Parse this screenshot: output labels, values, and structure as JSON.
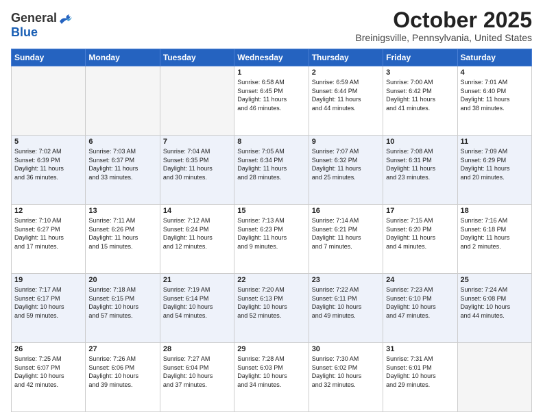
{
  "header": {
    "logo_general": "General",
    "logo_blue": "Blue",
    "month": "October 2025",
    "location": "Breinigsville, Pennsylvania, United States"
  },
  "days_of_week": [
    "Sunday",
    "Monday",
    "Tuesday",
    "Wednesday",
    "Thursday",
    "Friday",
    "Saturday"
  ],
  "weeks": [
    [
      {
        "day": "",
        "content": ""
      },
      {
        "day": "",
        "content": ""
      },
      {
        "day": "",
        "content": ""
      },
      {
        "day": "1",
        "content": "Sunrise: 6:58 AM\nSunset: 6:45 PM\nDaylight: 11 hours\nand 46 minutes."
      },
      {
        "day": "2",
        "content": "Sunrise: 6:59 AM\nSunset: 6:44 PM\nDaylight: 11 hours\nand 44 minutes."
      },
      {
        "day": "3",
        "content": "Sunrise: 7:00 AM\nSunset: 6:42 PM\nDaylight: 11 hours\nand 41 minutes."
      },
      {
        "day": "4",
        "content": "Sunrise: 7:01 AM\nSunset: 6:40 PM\nDaylight: 11 hours\nand 38 minutes."
      }
    ],
    [
      {
        "day": "5",
        "content": "Sunrise: 7:02 AM\nSunset: 6:39 PM\nDaylight: 11 hours\nand 36 minutes."
      },
      {
        "day": "6",
        "content": "Sunrise: 7:03 AM\nSunset: 6:37 PM\nDaylight: 11 hours\nand 33 minutes."
      },
      {
        "day": "7",
        "content": "Sunrise: 7:04 AM\nSunset: 6:35 PM\nDaylight: 11 hours\nand 30 minutes."
      },
      {
        "day": "8",
        "content": "Sunrise: 7:05 AM\nSunset: 6:34 PM\nDaylight: 11 hours\nand 28 minutes."
      },
      {
        "day": "9",
        "content": "Sunrise: 7:07 AM\nSunset: 6:32 PM\nDaylight: 11 hours\nand 25 minutes."
      },
      {
        "day": "10",
        "content": "Sunrise: 7:08 AM\nSunset: 6:31 PM\nDaylight: 11 hours\nand 23 minutes."
      },
      {
        "day": "11",
        "content": "Sunrise: 7:09 AM\nSunset: 6:29 PM\nDaylight: 11 hours\nand 20 minutes."
      }
    ],
    [
      {
        "day": "12",
        "content": "Sunrise: 7:10 AM\nSunset: 6:27 PM\nDaylight: 11 hours\nand 17 minutes."
      },
      {
        "day": "13",
        "content": "Sunrise: 7:11 AM\nSunset: 6:26 PM\nDaylight: 11 hours\nand 15 minutes."
      },
      {
        "day": "14",
        "content": "Sunrise: 7:12 AM\nSunset: 6:24 PM\nDaylight: 11 hours\nand 12 minutes."
      },
      {
        "day": "15",
        "content": "Sunrise: 7:13 AM\nSunset: 6:23 PM\nDaylight: 11 hours\nand 9 minutes."
      },
      {
        "day": "16",
        "content": "Sunrise: 7:14 AM\nSunset: 6:21 PM\nDaylight: 11 hours\nand 7 minutes."
      },
      {
        "day": "17",
        "content": "Sunrise: 7:15 AM\nSunset: 6:20 PM\nDaylight: 11 hours\nand 4 minutes."
      },
      {
        "day": "18",
        "content": "Sunrise: 7:16 AM\nSunset: 6:18 PM\nDaylight: 11 hours\nand 2 minutes."
      }
    ],
    [
      {
        "day": "19",
        "content": "Sunrise: 7:17 AM\nSunset: 6:17 PM\nDaylight: 10 hours\nand 59 minutes."
      },
      {
        "day": "20",
        "content": "Sunrise: 7:18 AM\nSunset: 6:15 PM\nDaylight: 10 hours\nand 57 minutes."
      },
      {
        "day": "21",
        "content": "Sunrise: 7:19 AM\nSunset: 6:14 PM\nDaylight: 10 hours\nand 54 minutes."
      },
      {
        "day": "22",
        "content": "Sunrise: 7:20 AM\nSunset: 6:13 PM\nDaylight: 10 hours\nand 52 minutes."
      },
      {
        "day": "23",
        "content": "Sunrise: 7:22 AM\nSunset: 6:11 PM\nDaylight: 10 hours\nand 49 minutes."
      },
      {
        "day": "24",
        "content": "Sunrise: 7:23 AM\nSunset: 6:10 PM\nDaylight: 10 hours\nand 47 minutes."
      },
      {
        "day": "25",
        "content": "Sunrise: 7:24 AM\nSunset: 6:08 PM\nDaylight: 10 hours\nand 44 minutes."
      }
    ],
    [
      {
        "day": "26",
        "content": "Sunrise: 7:25 AM\nSunset: 6:07 PM\nDaylight: 10 hours\nand 42 minutes."
      },
      {
        "day": "27",
        "content": "Sunrise: 7:26 AM\nSunset: 6:06 PM\nDaylight: 10 hours\nand 39 minutes."
      },
      {
        "day": "28",
        "content": "Sunrise: 7:27 AM\nSunset: 6:04 PM\nDaylight: 10 hours\nand 37 minutes."
      },
      {
        "day": "29",
        "content": "Sunrise: 7:28 AM\nSunset: 6:03 PM\nDaylight: 10 hours\nand 34 minutes."
      },
      {
        "day": "30",
        "content": "Sunrise: 7:30 AM\nSunset: 6:02 PM\nDaylight: 10 hours\nand 32 minutes."
      },
      {
        "day": "31",
        "content": "Sunrise: 7:31 AM\nSunset: 6:01 PM\nDaylight: 10 hours\nand 29 minutes."
      },
      {
        "day": "",
        "content": ""
      }
    ]
  ]
}
